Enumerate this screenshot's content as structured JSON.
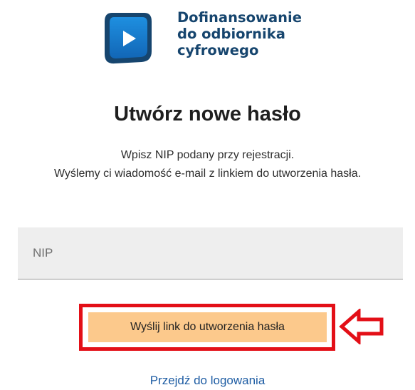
{
  "brand": {
    "line1": "Dofinansowanie",
    "line2": "do odbiornika",
    "line3": "cyfrowego",
    "logo_icon": "play-screen-icon",
    "color": "#16456e"
  },
  "page_title": "Utwórz nowe hasło",
  "description": {
    "line1": "Wpisz NIP podany przy rejestracji.",
    "line2": "Wyślemy ci wiadomość e-mail z linkiem do utworzenia hasła."
  },
  "form": {
    "nip_placeholder": "NIP",
    "nip_value": "",
    "submit_label": "Wyślij link do utworzenia hasła",
    "submit_color": "#fcc98c"
  },
  "annotation": {
    "highlight_color": "#e30f17",
    "arrow_icon": "left-arrow-icon"
  },
  "login_link": "Przejdź do logowania",
  "link_color": "#1d5ca3"
}
